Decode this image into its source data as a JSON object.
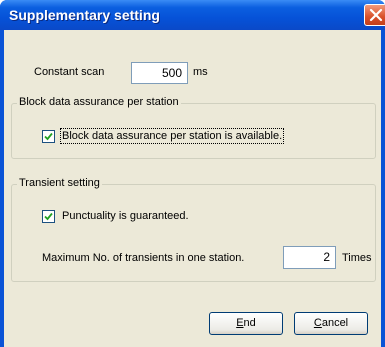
{
  "dialog": {
    "title": "Supplementary setting"
  },
  "constant_scan": {
    "label": "Constant scan",
    "value": "500",
    "unit": "ms"
  },
  "block_group": {
    "title": "Block data assurance per station",
    "checkbox_label": "Block data assurance per station is available.",
    "checked": true
  },
  "transient_group": {
    "title": "Transient setting",
    "checkbox_label": "Punctuality is guaranteed.",
    "checked": true,
    "max_label": "Maximum No. of transients in one station.",
    "max_value": "2",
    "max_unit": "Times"
  },
  "buttons": {
    "end": {
      "mnemonic": "E",
      "rest": "nd"
    },
    "cancel": {
      "mnemonic": "C",
      "rest": "ancel"
    }
  },
  "colors": {
    "title_bar": "#0652d8",
    "dialog_face": "#ece9d8",
    "close_button": "#d8502a"
  }
}
